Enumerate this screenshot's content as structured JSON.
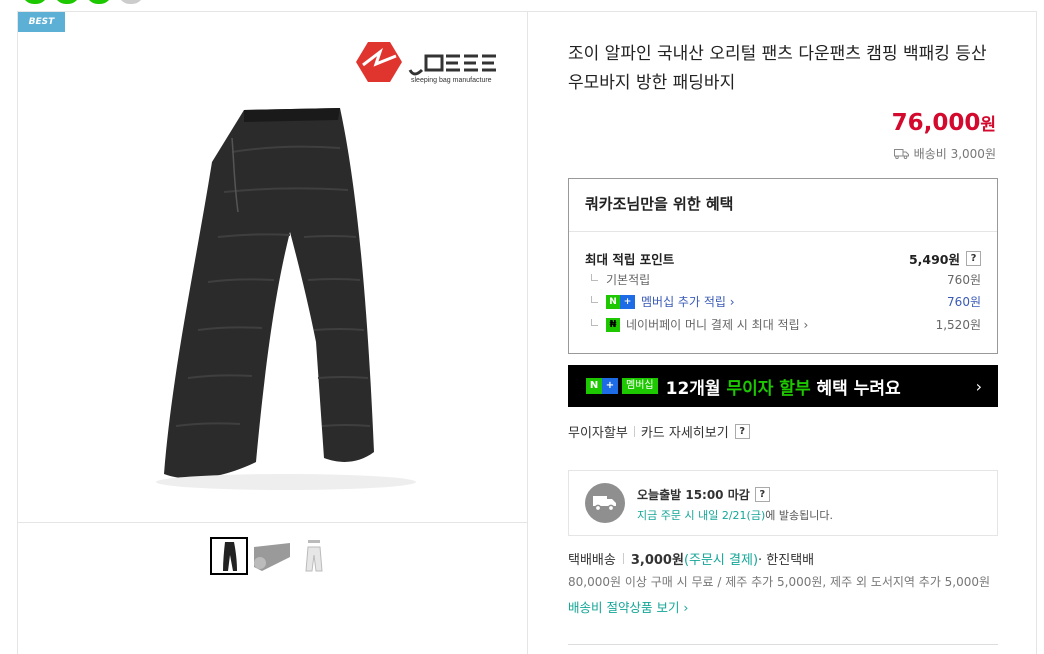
{
  "badge": {
    "best": "BEST"
  },
  "product": {
    "title": "조이 알파인 국내산 오리털 팬츠 다운팬츠 캠핑 백패킹 등산 우모바지 방한 패딩바지",
    "price": "76,000",
    "price_unit": "원",
    "shipping_fee_label": "배송비 3,000원"
  },
  "logo": {
    "brand": "JOEE",
    "tagline": "sleeping bag manufacture"
  },
  "benefits": {
    "title": "쿼카조님만을 위한 혜택",
    "max_points_label": "최대 적립 포인트",
    "max_points_value": "5,490원",
    "basic_label": "기본적립",
    "basic_value": "760원",
    "membership_label": "멤버십 추가 적립 ›",
    "membership_value": "760원",
    "npay_label": "네이버페이 머니 결제 시 최대 적립 ›",
    "npay_value": "1,520원"
  },
  "banner": {
    "membership": "멤버십",
    "text_months": "12개월",
    "text_highlight": "무이자 할부",
    "text_rest": "혜택 누려요",
    "arrow": "›"
  },
  "card": {
    "installment": "무이자할부",
    "card_detail": "카드 자세히보기"
  },
  "today_shipping": {
    "headline": "오늘출발 15:00 마감",
    "desc_green": "지금 주문 시 내일 2/21(금)",
    "desc_rest": "에 발송됩니다."
  },
  "delivery": {
    "method": "택배배송",
    "fee": "3,000원",
    "fee_note": "(주문시 결제)",
    "carrier": "· 한진택배",
    "condition": "80,000원 이상 구매 시 무료 / 제주 추가 5,000원, 제주 외 도서지역 추가 5,000원",
    "saving_link": "배송비 절약상품 보기 ›"
  },
  "help_mark": "?",
  "icons": {
    "truck": "truck-icon",
    "delivery_truck": "delivery-truck-icon",
    "naver_plus": "naver-plus-icon",
    "naver_pay": "naver-pay-icon"
  },
  "colors": {
    "price_red": "#d3092d",
    "naver_green": "#1ec800",
    "naver_blue": "#1e6be6",
    "teal": "#14a697",
    "best_blue": "#5cb0d6"
  }
}
